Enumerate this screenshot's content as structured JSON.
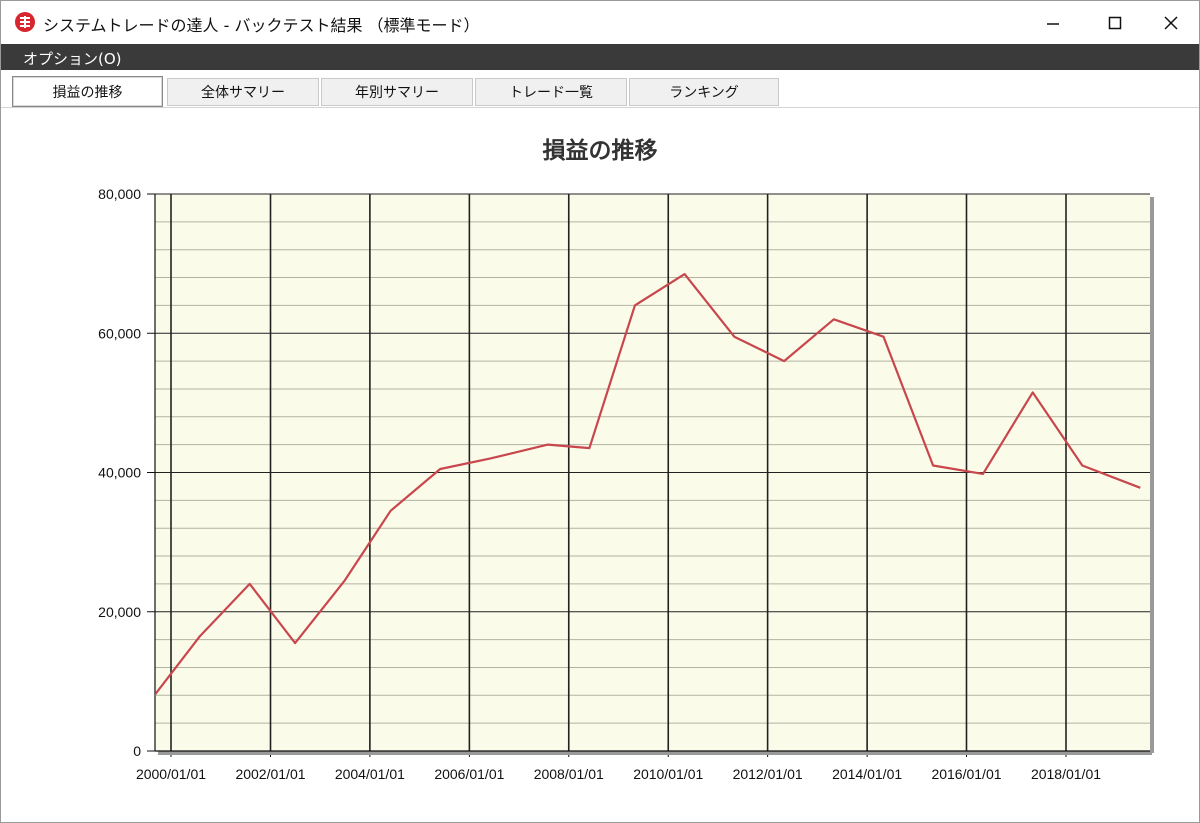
{
  "window": {
    "title": "システムトレードの達人 - バックテスト結果 （標準モード）",
    "controls": {
      "minimize": "—",
      "maximize": "☐",
      "close": "✕"
    }
  },
  "menu": {
    "items": [
      "オプション(O)"
    ]
  },
  "tabs": [
    {
      "label": "損益の推移",
      "active": true
    },
    {
      "label": "全体サマリー",
      "active": false
    },
    {
      "label": "年別サマリー",
      "active": false
    },
    {
      "label": "トレード一覧",
      "active": false
    },
    {
      "label": "ランキング",
      "active": false
    }
  ],
  "colors": {
    "plot_background": "#fbfbea",
    "series_line": "#c8474c",
    "grid_major": "#222222",
    "grid_minor": "#b3b3a3",
    "menubar": "#3a3a3a",
    "app_icon": "#d8262e"
  },
  "chart_data": {
    "type": "line",
    "title": "損益の推移",
    "xlabel": "",
    "ylabel": "",
    "ylim": [
      0,
      80000
    ],
    "yticks": [
      "0",
      "20,000",
      "40,000",
      "60,000",
      "80,000"
    ],
    "ytick_values": [
      0,
      20000,
      40000,
      60000,
      80000
    ],
    "xticks": [
      "2000/01/01",
      "2002/01/01",
      "2004/01/01",
      "2006/01/01",
      "2008/01/01",
      "2010/01/01",
      "2012/01/01",
      "2014/01/01",
      "2016/01/01",
      "2018/01/01"
    ],
    "grid": true,
    "legend": "none",
    "series": [
      {
        "x": [
          "1999-09-01",
          "2000-08-01",
          "2001-08-01",
          "2002-07-01",
          "2003-07-01",
          "2004-06-01",
          "2005-06-01",
          "2006-06-01",
          "2007-08-01",
          "2008-06-01",
          "2009-05-01",
          "2010-05-01",
          "2011-05-01",
          "2012-05-01",
          "2013-05-01",
          "2014-05-01",
          "2015-05-01",
          "2016-05-01",
          "2017-05-01",
          "2018-05-01",
          "2019-07-01"
        ],
        "y": [
          8000,
          16500,
          24000,
          15500,
          24500,
          34500,
          40500,
          42000,
          44000,
          43500,
          64000,
          68500,
          59500,
          56000,
          62000,
          59500,
          41000,
          39800,
          51500,
          41000,
          37800
        ]
      }
    ]
  }
}
